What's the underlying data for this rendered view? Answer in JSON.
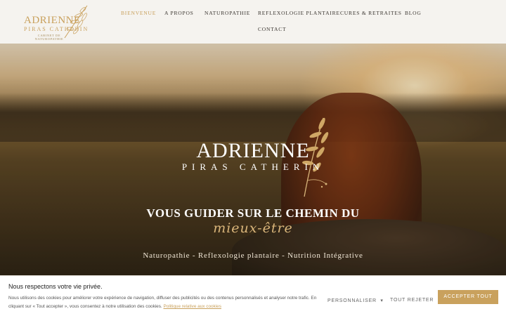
{
  "logo": {
    "name": "ADRIENNE",
    "subname": "PIRAS CATHERIN",
    "tagline": "CABINET DE NATUROPATHIE"
  },
  "nav": {
    "items": [
      {
        "label": "BIENVENUE",
        "active": true
      },
      {
        "label": "A PROPOS",
        "active": false
      },
      {
        "label": "NATUROPATHIE",
        "active": false
      },
      {
        "label": "REFLEXOLOGIE PLANTAIRE",
        "active": false
      },
      {
        "label": "CURES & RETRAITES",
        "active": false
      },
      {
        "label": "BLOG",
        "active": false
      },
      {
        "label": "CONTACT",
        "active": false
      }
    ]
  },
  "hero": {
    "name": "ADRIENNE",
    "surname": "PIRAS CATHERIN",
    "title": "VOUS GUIDER SUR LE CHEMIN DU",
    "script": "mieux-être",
    "services": "Naturopathie - Reflexologie plantaire - Nutrition Intégrative"
  },
  "cookie": {
    "title": "Nous respectons votre vie privée.",
    "text": "Nous utilisons des cookies pour améliorer votre expérience de navigation, diffuser des publicités ou des contenus personnalisés et analyser notre trafic. En cliquant sur « Tout accepter », vous consentez à notre utilisation des cookies.",
    "link": "Politique relative aux cookies",
    "customize": "PERSONNALISER",
    "reject": "TOUT REJETER",
    "accept": "ACCEPTER TOUT"
  },
  "colors": {
    "accent": "#c9a15d",
    "header_bg": "#f5f3ef",
    "nav_text": "#3a3530"
  }
}
